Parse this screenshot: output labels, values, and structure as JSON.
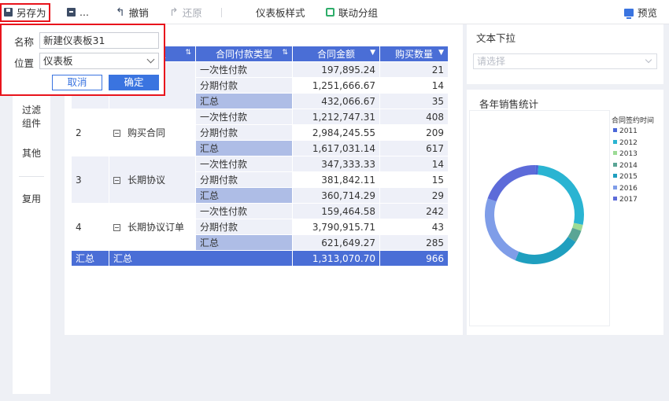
{
  "toolbar": {
    "save_as": "另存为",
    "more": "...",
    "undo": "撤销",
    "redo": "还原",
    "dashboard_style": "仪表板样式",
    "linkage_group": "联动分组",
    "preview": "预览"
  },
  "left_nav": {
    "items": [
      "过滤\n组件",
      "其他",
      "复用"
    ]
  },
  "save_dialog": {
    "name_label": "名称",
    "name_value": "新建仪表板31",
    "location_label": "位置",
    "location_value": "仪表板",
    "cancel_label": "取消",
    "ok_label": "确定"
  },
  "table": {
    "headers": {
      "type_partial": "型",
      "payment_type": "合同付款类型",
      "amount": "合同金额",
      "quantity": "购买数量"
    },
    "groups": [
      {
        "index": "",
        "name": "",
        "rows": [
          {
            "type": "一次性付款",
            "amount": "197,895.24",
            "qty": "21"
          },
          {
            "type": "分期付款",
            "amount": "1,251,666.67",
            "qty": "14"
          },
          {
            "type": "汇总",
            "amount": "432,066.67",
            "qty": "35"
          }
        ]
      },
      {
        "index": "2",
        "name": "购买合同",
        "rows": [
          {
            "type": "一次性付款",
            "amount": "1,212,747.31",
            "qty": "408"
          },
          {
            "type": "分期付款",
            "amount": "2,984,245.55",
            "qty": "209"
          },
          {
            "type": "汇总",
            "amount": "1,617,031.14",
            "qty": "617"
          }
        ]
      },
      {
        "index": "3",
        "name": "长期协议",
        "rows": [
          {
            "type": "一次性付款",
            "amount": "347,333.33",
            "qty": "14"
          },
          {
            "type": "分期付款",
            "amount": "381,842.11",
            "qty": "15"
          },
          {
            "type": "汇总",
            "amount": "360,714.29",
            "qty": "29"
          }
        ]
      },
      {
        "index": "4",
        "name": "长期协议订单",
        "rows": [
          {
            "type": "一次性付款",
            "amount": "159,464.58",
            "qty": "242"
          },
          {
            "type": "分期付款",
            "amount": "3,790,915.71",
            "qty": "43"
          },
          {
            "type": "汇总",
            "amount": "621,649.27",
            "qty": "285"
          }
        ]
      }
    ],
    "total": {
      "index": "汇总",
      "name": "汇总",
      "amount": "1,313,070.70",
      "qty": "966"
    }
  },
  "dropdown_widget": {
    "title": "文本下拉",
    "placeholder": "请选择"
  },
  "chart_widget": {
    "title": "各年销售统计"
  },
  "chart_data": {
    "type": "pie",
    "title": "各年销售统计",
    "legend_title": "合同签约时间",
    "legend_position": "right",
    "donut": true,
    "categories": [
      "2011",
      "2012",
      "2013",
      "2014",
      "2015",
      "2016",
      "2017"
    ],
    "values": [
      1,
      27,
      2,
      4,
      22,
      24,
      20
    ],
    "colors": [
      "#4b67d8",
      "#2ab4d2",
      "#9cdb95",
      "#5aa595",
      "#1f9fbf",
      "#7f9de8",
      "#5d6bd9"
    ]
  }
}
